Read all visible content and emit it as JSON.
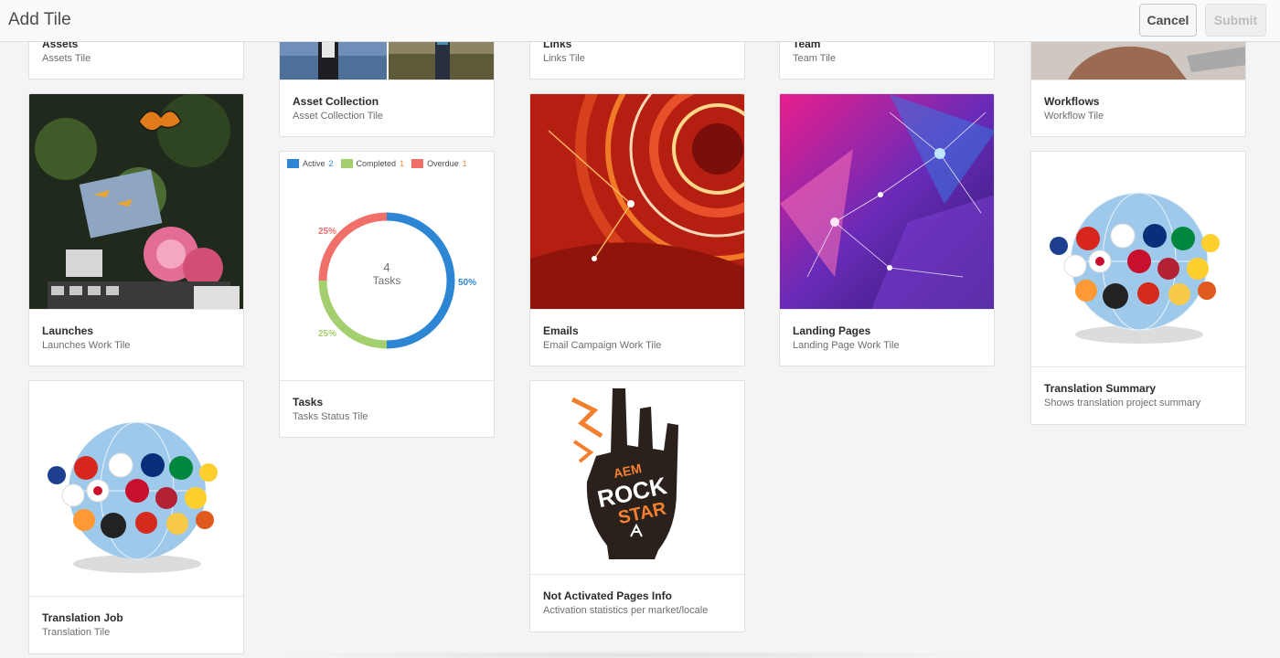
{
  "header": {
    "title": "Add Tile",
    "cancel_label": "Cancel",
    "submit_label": "Submit"
  },
  "tiles": [
    {
      "title": "Assets",
      "subtitle": "Assets Tile"
    },
    {
      "title": "Asset Collection",
      "subtitle": "Asset Collection Tile"
    },
    {
      "title": "Links",
      "subtitle": "Links Tile"
    },
    {
      "title": "Team",
      "subtitle": "Team Tile"
    },
    {
      "title": "Workflows",
      "subtitle": "Workflow Tile"
    },
    {
      "title": "Launches",
      "subtitle": "Launches Work Tile"
    },
    {
      "title": "Tasks",
      "subtitle": "Tasks Status Tile"
    },
    {
      "title": "Emails",
      "subtitle": "Email Campaign Work Tile"
    },
    {
      "title": "Landing Pages",
      "subtitle": "Landing Page Work Tile"
    },
    {
      "title": "Translation Summary",
      "subtitle": "Shows translation project summary"
    },
    {
      "title": "Translation Job",
      "subtitle": "Translation Tile"
    },
    {
      "title": "Not Activated Pages Info",
      "subtitle": "Activation statistics per market/locale"
    }
  ],
  "tasks_chart": {
    "legend": [
      {
        "label": "Active",
        "count": "2",
        "color": "#2d86d4"
      },
      {
        "label": "Completed",
        "count": "1",
        "color": "#a3cf6f"
      },
      {
        "label": "Overdue",
        "count": "1",
        "color": "#f07069"
      }
    ],
    "center_value": "4",
    "center_label": "Tasks",
    "labels": {
      "active": "50%",
      "completed": "25%",
      "overdue": "25%"
    }
  },
  "logo_text": {
    "line1": "AEM",
    "line2": "ROCK",
    "line3": "STAR"
  },
  "colors": {
    "accent_blue": "#2d86d4",
    "green": "#a3cf6f",
    "red": "#f07069",
    "orange": "#f3802f"
  }
}
